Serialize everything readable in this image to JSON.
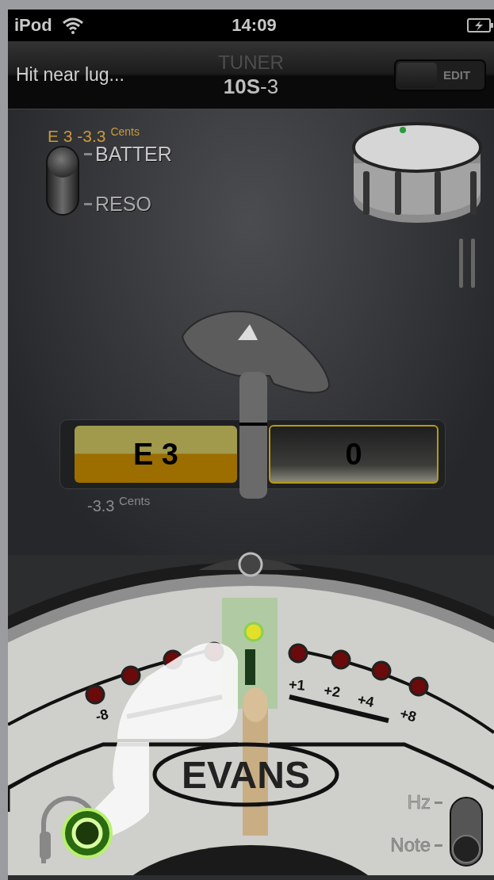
{
  "status_bar": {
    "carrier": "iPod",
    "time": "14:09"
  },
  "nav_bar": {
    "hint": "Hit near lug...",
    "title": "TUNER",
    "subtitle": "**10S**-3",
    "edit_toggle": {
      "label": "EDIT",
      "on": false
    }
  },
  "readout": "E 3 -3.3 $^{Cents}$",
  "head_switch": [
    {
      "label": "BATTER",
      "selected": true
    },
    {
      "label": "RESO",
      "selected": false
    }
  ],
  "display": {
    "note": "E 3",
    "value": "0",
    "cents": "-3.3 $^{Cents}$"
  },
  "gauge": {
    "lights": [
      {
        "on": false
      },
      {
        "on": false
      },
      {
        "on": false
      },
      {
        "on": false
      },
      {
        "on": true
      },
      {
        "on": false
      },
      {
        "on": false
      },
      {
        "on": false
      },
      {
        "on": false
      }
    ],
    "tick_labels": [
      "-8",
      "+1",
      "+2",
      "+4",
      "+8"
    ],
    "logo": "EVANS"
  },
  "display_mode": [
    {
      "label": "Hz",
      "selected": false
    },
    {
      "label": "Note",
      "selected": true
    }
  ]
}
